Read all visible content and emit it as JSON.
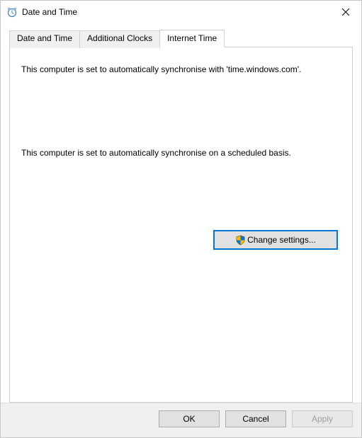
{
  "window": {
    "title": "Date and Time"
  },
  "tabs": {
    "items": [
      {
        "label": "Date and Time",
        "active": false
      },
      {
        "label": "Additional Clocks",
        "active": false
      },
      {
        "label": "Internet Time",
        "active": true
      }
    ]
  },
  "panel": {
    "sync_text": "This computer is set to automatically synchronise with 'time.windows.com'.",
    "schedule_text": "This computer is set to automatically synchronise on a scheduled basis.",
    "change_settings_label": "Change settings..."
  },
  "buttons": {
    "ok": "OK",
    "cancel": "Cancel",
    "apply": "Apply"
  }
}
